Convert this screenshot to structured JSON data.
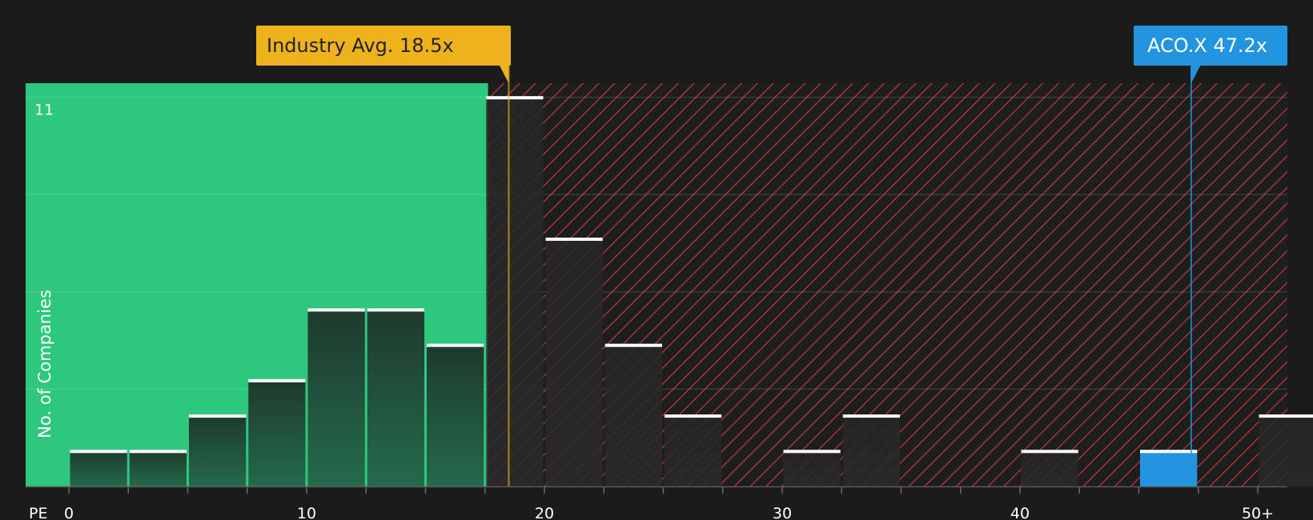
{
  "chart_data": {
    "type": "bar",
    "metric_label": "PE",
    "ylabel": "No. of Companies",
    "y_tick_labels": [
      {
        "value": 11,
        "label": "11"
      }
    ],
    "ylim": [
      0,
      11.4
    ],
    "y_gridlines": [
      2.75,
      5.5,
      8.25,
      11
    ],
    "x_range": [
      0,
      51.5
    ],
    "x_ticks": [
      {
        "value": 0,
        "label": "0"
      },
      {
        "value": 10,
        "label": "10"
      },
      {
        "value": 20,
        "label": "20"
      },
      {
        "value": 30,
        "label": "30"
      },
      {
        "value": 40,
        "label": "40"
      },
      {
        "value": 50,
        "label": "50+"
      }
    ],
    "bin_width": 2.5,
    "bins": [
      {
        "from": 0,
        "to": 2.5,
        "count": 1
      },
      {
        "from": 2.5,
        "to": 5,
        "count": 1
      },
      {
        "from": 5,
        "to": 7.5,
        "count": 2
      },
      {
        "from": 7.5,
        "to": 10,
        "count": 3
      },
      {
        "from": 10,
        "to": 12.5,
        "count": 5
      },
      {
        "from": 12.5,
        "to": 15,
        "count": 5
      },
      {
        "from": 15,
        "to": 17.5,
        "count": 4
      },
      {
        "from": 17.5,
        "to": 20,
        "count": 11
      },
      {
        "from": 20,
        "to": 22.5,
        "count": 7
      },
      {
        "from": 22.5,
        "to": 25,
        "count": 4
      },
      {
        "from": 25,
        "to": 27.5,
        "count": 2
      },
      {
        "from": 27.5,
        "to": 30,
        "count": 0
      },
      {
        "from": 30,
        "to": 32.5,
        "count": 1
      },
      {
        "from": 32.5,
        "to": 35,
        "count": 2
      },
      {
        "from": 35,
        "to": 37.5,
        "count": 0
      },
      {
        "from": 37.5,
        "to": 40,
        "count": 0
      },
      {
        "from": 40,
        "to": 42.5,
        "count": 1
      },
      {
        "from": 42.5,
        "to": 45,
        "count": 0
      },
      {
        "from": 45,
        "to": 47.5,
        "count": 1,
        "highlight": true
      },
      {
        "from": 47.5,
        "to": 50,
        "count": 0
      },
      {
        "from": 50,
        "to": 52.5,
        "count": 2
      }
    ],
    "undervalued_threshold": 17.5,
    "industry_avg": {
      "value": 18.5,
      "label": "Industry Avg. 18.5x"
    },
    "company": {
      "value": 47.2,
      "label": "ACO.X 47.2x"
    },
    "colors": {
      "background": "#1b1b1b",
      "undervalued_zone": "#2ec77e",
      "overvalued_zone": "#1e1e1e",
      "hatch": "#d63a3a",
      "bar_dark": "#1f3d30",
      "bar_dark_bottom": "#24644a",
      "bar_top": "#ffffff",
      "company_bar": "#2394e0",
      "industry_avg": "#eeb31c"
    }
  }
}
